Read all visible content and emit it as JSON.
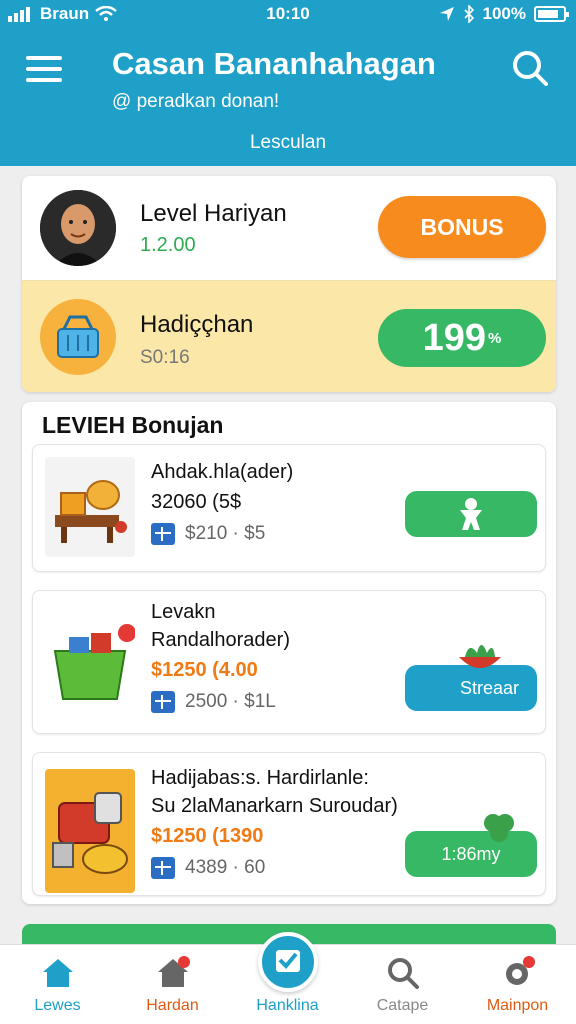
{
  "status_bar": {
    "carrier": "Braun",
    "time": "10:10",
    "battery": "100%"
  },
  "header": {
    "title": "Casan Bananhahagan",
    "subtitle": "@ peradkan donan!",
    "tab": "Lesculan"
  },
  "summary": {
    "level": {
      "title": "Level Hariyan",
      "value": "1.2.00",
      "button": "BONUS"
    },
    "prize": {
      "title": "Hadiççhan",
      "value": "S0:16",
      "button_big": "199",
      "button_small": "% "
    }
  },
  "bonus_panel": {
    "title": "LEVIEH Bonujan",
    "items": [
      {
        "line1": "Ahdak.hla(ader)",
        "line2": "32060 (5$",
        "meta": "$210 · $5",
        "action": "",
        "action_icon": "person-icon"
      },
      {
        "line1": "Levakn",
        "line2": "Randalhorader)",
        "line3": "$1250 (4.00",
        "meta": "2500 · $1L",
        "action": "Streaar",
        "action_icon": "salad-bowl-icon"
      },
      {
        "line1": "Hadijabas:s. Hardirlanle:",
        "line2": "Su 2laManarkarn Suroudar)",
        "line3": "$1250 (1390",
        "meta": "4389 · 60",
        "action": "1:86my",
        "action_icon": "clover-icon"
      }
    ]
  },
  "nav": {
    "items": [
      {
        "label": "Lewes",
        "icon": "home-icon",
        "color": "#1ea0c8"
      },
      {
        "label": "Hardan",
        "icon": "house-badge-icon",
        "color": "#e05a12"
      },
      {
        "label": "Hanklina",
        "icon": "check-box-icon",
        "color": "#1ea0c8"
      },
      {
        "label": "Catape",
        "icon": "search-icon",
        "color": "#888888"
      },
      {
        "label": "Mainpon",
        "icon": "settings-icon",
        "color": "#e05a12"
      }
    ]
  },
  "colors": {
    "accent": "#1ea0c8",
    "bonus": "#f78b1e",
    "green": "#36b864",
    "blue_action": "#1ea0c8"
  }
}
